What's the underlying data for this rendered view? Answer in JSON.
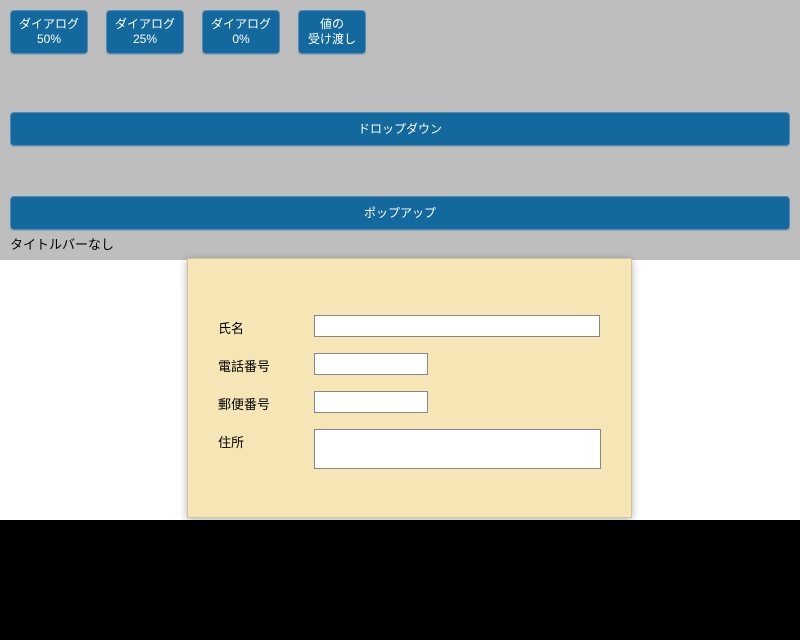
{
  "buttons": {
    "dialog50": {
      "line1": "ダイアログ",
      "line2": "50%"
    },
    "dialog25": {
      "line1": "ダイアログ",
      "line2": "25%"
    },
    "dialog0": {
      "line1": "ダイアログ",
      "line2": "0%"
    },
    "passing": {
      "line1": "値の",
      "line2": "受け渡し"
    },
    "dropdown": {
      "label": "ドロップダウン"
    },
    "popup": {
      "label": "ポップアップ"
    }
  },
  "captions": {
    "noTitlebar": "タイトルバーなし"
  },
  "form": {
    "fields": {
      "name": {
        "label": "氏名",
        "value": ""
      },
      "tel": {
        "label": "電話番号",
        "value": ""
      },
      "zip": {
        "label": "郵便番号",
        "value": ""
      },
      "address": {
        "label": "住所",
        "value": ""
      }
    }
  }
}
